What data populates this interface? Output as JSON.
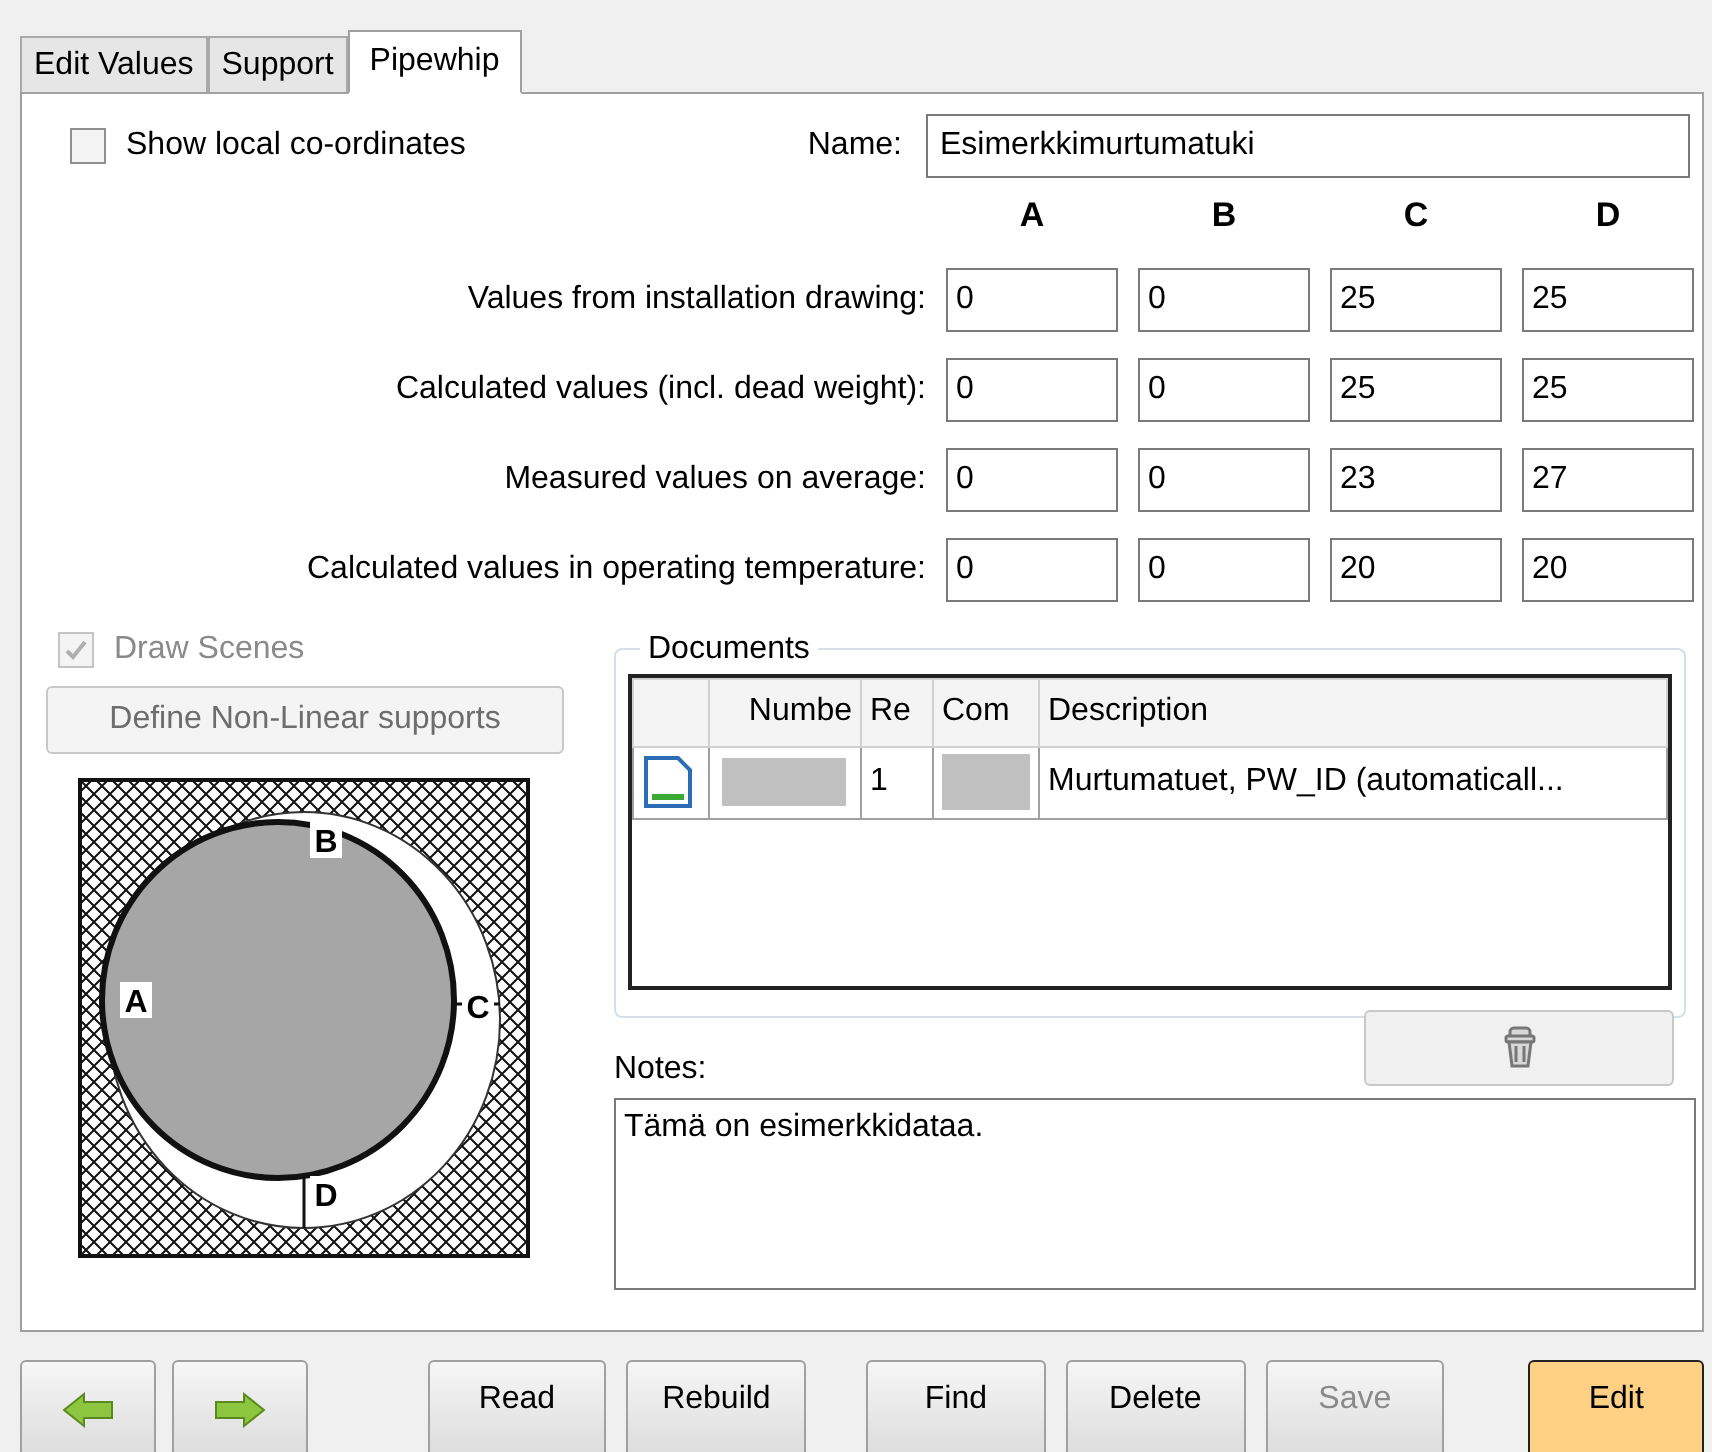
{
  "tabs": [
    {
      "label": "Edit Values",
      "selected": false
    },
    {
      "label": "Support",
      "selected": false
    },
    {
      "label": "Pipewhip",
      "selected": true
    }
  ],
  "show_local_coordinates": {
    "label": "Show local co-ordinates",
    "checked": false
  },
  "name_field": {
    "label": "Name:",
    "value": "Esimerkkimurtumatuki"
  },
  "value_columns": [
    "A",
    "B",
    "C",
    "D"
  ],
  "value_rows": [
    {
      "label": "Values from installation drawing:",
      "values": [
        "0",
        "0",
        "25",
        "25"
      ]
    },
    {
      "label": "Calculated values (incl. dead weight):",
      "values": [
        "0",
        "0",
        "25",
        "25"
      ]
    },
    {
      "label": "Measured values on average:",
      "values": [
        "0",
        "0",
        "23",
        "27"
      ]
    },
    {
      "label": "Calculated values in operating temperature:",
      "values": [
        "0",
        "0",
        "20",
        "20"
      ]
    }
  ],
  "draw_scenes": {
    "label": "Draw Scenes",
    "checked": true,
    "disabled": true
  },
  "define_button": {
    "label": "Define Non-Linear supports",
    "disabled": true
  },
  "diagram_labels": [
    "A",
    "B",
    "C",
    "D"
  ],
  "documents": {
    "title": "Documents",
    "columns": [
      "",
      "Numbe",
      "Re",
      "Com",
      "Description"
    ],
    "rows": [
      {
        "number_blank": true,
        "revision": "1",
        "comment_blank": true,
        "description": "Murtumatuet, PW_ID (automaticall..."
      }
    ]
  },
  "notes": {
    "label": "Notes:",
    "value": "Tämä on esimerkkidataa."
  },
  "buttons": [
    {
      "kind": "back"
    },
    {
      "kind": "forward"
    },
    {
      "kind": "text",
      "label": "Read",
      "disabled": false
    },
    {
      "kind": "text",
      "label": "Rebuild",
      "disabled": false
    },
    {
      "kind": "text",
      "label": "Find",
      "disabled": false
    },
    {
      "kind": "text",
      "label": "Delete",
      "disabled": false
    },
    {
      "kind": "text",
      "label": "Save",
      "disabled": true
    },
    {
      "kind": "text",
      "label": "Edit",
      "disabled": false,
      "selected": true
    }
  ]
}
